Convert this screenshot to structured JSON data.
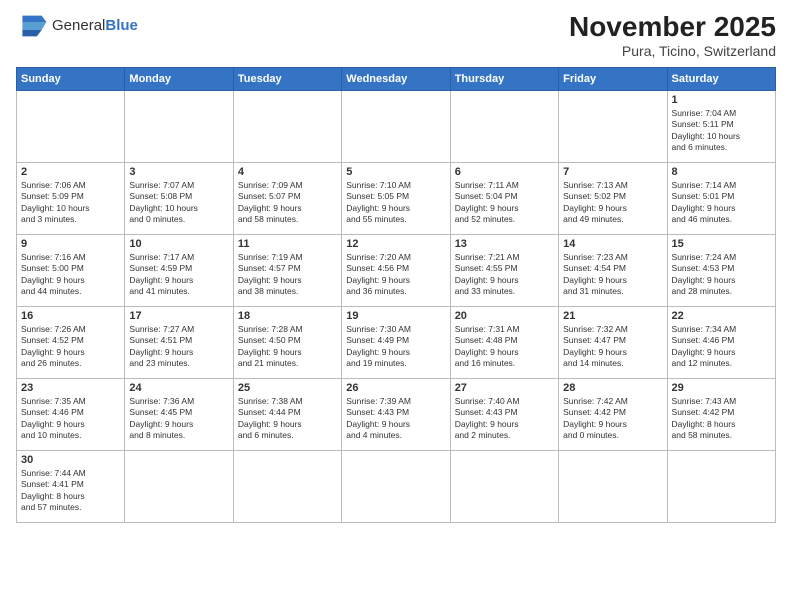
{
  "logo": {
    "text_general": "General",
    "text_blue": "Blue"
  },
  "title": "November 2025",
  "subtitle": "Pura, Ticino, Switzerland",
  "weekdays": [
    "Sunday",
    "Monday",
    "Tuesday",
    "Wednesday",
    "Thursday",
    "Friday",
    "Saturday"
  ],
  "weeks": [
    [
      {
        "day": "",
        "info": ""
      },
      {
        "day": "",
        "info": ""
      },
      {
        "day": "",
        "info": ""
      },
      {
        "day": "",
        "info": ""
      },
      {
        "day": "",
        "info": ""
      },
      {
        "day": "",
        "info": ""
      },
      {
        "day": "1",
        "info": "Sunrise: 7:04 AM\nSunset: 5:11 PM\nDaylight: 10 hours\nand 6 minutes."
      }
    ],
    [
      {
        "day": "2",
        "info": "Sunrise: 7:06 AM\nSunset: 5:09 PM\nDaylight: 10 hours\nand 3 minutes."
      },
      {
        "day": "3",
        "info": "Sunrise: 7:07 AM\nSunset: 5:08 PM\nDaylight: 10 hours\nand 0 minutes."
      },
      {
        "day": "4",
        "info": "Sunrise: 7:09 AM\nSunset: 5:07 PM\nDaylight: 9 hours\nand 58 minutes."
      },
      {
        "day": "5",
        "info": "Sunrise: 7:10 AM\nSunset: 5:05 PM\nDaylight: 9 hours\nand 55 minutes."
      },
      {
        "day": "6",
        "info": "Sunrise: 7:11 AM\nSunset: 5:04 PM\nDaylight: 9 hours\nand 52 minutes."
      },
      {
        "day": "7",
        "info": "Sunrise: 7:13 AM\nSunset: 5:02 PM\nDaylight: 9 hours\nand 49 minutes."
      },
      {
        "day": "8",
        "info": "Sunrise: 7:14 AM\nSunset: 5:01 PM\nDaylight: 9 hours\nand 46 minutes."
      }
    ],
    [
      {
        "day": "9",
        "info": "Sunrise: 7:16 AM\nSunset: 5:00 PM\nDaylight: 9 hours\nand 44 minutes."
      },
      {
        "day": "10",
        "info": "Sunrise: 7:17 AM\nSunset: 4:59 PM\nDaylight: 9 hours\nand 41 minutes."
      },
      {
        "day": "11",
        "info": "Sunrise: 7:19 AM\nSunset: 4:57 PM\nDaylight: 9 hours\nand 38 minutes."
      },
      {
        "day": "12",
        "info": "Sunrise: 7:20 AM\nSunset: 4:56 PM\nDaylight: 9 hours\nand 36 minutes."
      },
      {
        "day": "13",
        "info": "Sunrise: 7:21 AM\nSunset: 4:55 PM\nDaylight: 9 hours\nand 33 minutes."
      },
      {
        "day": "14",
        "info": "Sunrise: 7:23 AM\nSunset: 4:54 PM\nDaylight: 9 hours\nand 31 minutes."
      },
      {
        "day": "15",
        "info": "Sunrise: 7:24 AM\nSunset: 4:53 PM\nDaylight: 9 hours\nand 28 minutes."
      }
    ],
    [
      {
        "day": "16",
        "info": "Sunrise: 7:26 AM\nSunset: 4:52 PM\nDaylight: 9 hours\nand 26 minutes."
      },
      {
        "day": "17",
        "info": "Sunrise: 7:27 AM\nSunset: 4:51 PM\nDaylight: 9 hours\nand 23 minutes."
      },
      {
        "day": "18",
        "info": "Sunrise: 7:28 AM\nSunset: 4:50 PM\nDaylight: 9 hours\nand 21 minutes."
      },
      {
        "day": "19",
        "info": "Sunrise: 7:30 AM\nSunset: 4:49 PM\nDaylight: 9 hours\nand 19 minutes."
      },
      {
        "day": "20",
        "info": "Sunrise: 7:31 AM\nSunset: 4:48 PM\nDaylight: 9 hours\nand 16 minutes."
      },
      {
        "day": "21",
        "info": "Sunrise: 7:32 AM\nSunset: 4:47 PM\nDaylight: 9 hours\nand 14 minutes."
      },
      {
        "day": "22",
        "info": "Sunrise: 7:34 AM\nSunset: 4:46 PM\nDaylight: 9 hours\nand 12 minutes."
      }
    ],
    [
      {
        "day": "23",
        "info": "Sunrise: 7:35 AM\nSunset: 4:46 PM\nDaylight: 9 hours\nand 10 minutes."
      },
      {
        "day": "24",
        "info": "Sunrise: 7:36 AM\nSunset: 4:45 PM\nDaylight: 9 hours\nand 8 minutes."
      },
      {
        "day": "25",
        "info": "Sunrise: 7:38 AM\nSunset: 4:44 PM\nDaylight: 9 hours\nand 6 minutes."
      },
      {
        "day": "26",
        "info": "Sunrise: 7:39 AM\nSunset: 4:43 PM\nDaylight: 9 hours\nand 4 minutes."
      },
      {
        "day": "27",
        "info": "Sunrise: 7:40 AM\nSunset: 4:43 PM\nDaylight: 9 hours\nand 2 minutes."
      },
      {
        "day": "28",
        "info": "Sunrise: 7:42 AM\nSunset: 4:42 PM\nDaylight: 9 hours\nand 0 minutes."
      },
      {
        "day": "29",
        "info": "Sunrise: 7:43 AM\nSunset: 4:42 PM\nDaylight: 8 hours\nand 58 minutes."
      }
    ],
    [
      {
        "day": "30",
        "info": "Sunrise: 7:44 AM\nSunset: 4:41 PM\nDaylight: 8 hours\nand 57 minutes."
      },
      {
        "day": "",
        "info": ""
      },
      {
        "day": "",
        "info": ""
      },
      {
        "day": "",
        "info": ""
      },
      {
        "day": "",
        "info": ""
      },
      {
        "day": "",
        "info": ""
      },
      {
        "day": "",
        "info": ""
      }
    ]
  ]
}
